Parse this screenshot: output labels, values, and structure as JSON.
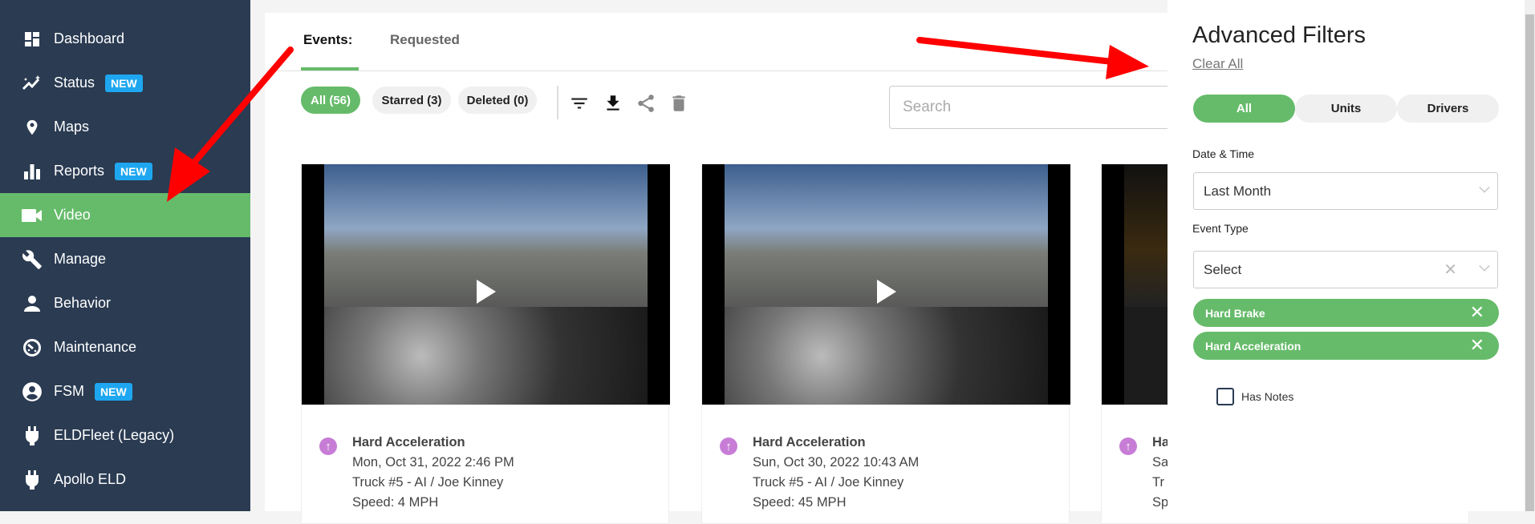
{
  "sidebar": {
    "items": [
      {
        "label": "Dashboard",
        "icon": "dashboard-icon"
      },
      {
        "label": "Status",
        "icon": "status-icon",
        "badge": "NEW"
      },
      {
        "label": "Maps",
        "icon": "map-pin-icon"
      },
      {
        "label": "Reports",
        "icon": "bar-chart-icon",
        "badge": "NEW"
      },
      {
        "label": "Video",
        "icon": "video-camera-icon",
        "active": true
      },
      {
        "label": "Manage",
        "icon": "wrench-icon"
      },
      {
        "label": "Behavior",
        "icon": "person-icon"
      },
      {
        "label": "Maintenance",
        "icon": "gauge-icon"
      },
      {
        "label": "FSM",
        "icon": "account-circle-icon",
        "badge": "NEW"
      },
      {
        "label": "ELDFleet (Legacy)",
        "icon": "plug-icon"
      },
      {
        "label": "Apollo ELD",
        "icon": "plug-icon"
      }
    ]
  },
  "main": {
    "tabs": [
      {
        "label": "Events:",
        "active": true
      },
      {
        "label": "Requested"
      }
    ],
    "filters": [
      {
        "label": "All (56)",
        "active": true
      },
      {
        "label": "Starred (3)"
      },
      {
        "label": "Deleted (0)"
      }
    ],
    "search_placeholder": "Search",
    "cards": [
      {
        "title": "Hard Acceleration",
        "date": "Mon, Oct 31, 2022 2:46 PM",
        "vehicle": "Truck #5 - AI / Joe Kinney",
        "speed": "Speed: 4 MPH"
      },
      {
        "title": "Hard Acceleration",
        "date": "Sun, Oct 30, 2022 10:43 AM",
        "vehicle": "Truck #5 - AI / Joe Kinney",
        "speed": "Speed: 45 MPH"
      },
      {
        "title": "Ha",
        "date": "Sa",
        "vehicle": "Tr",
        "speed": "Sp"
      }
    ]
  },
  "panel": {
    "title": "Advanced Filters",
    "clear_all": "Clear All",
    "segments": [
      {
        "label": "All",
        "active": true
      },
      {
        "label": "Units"
      },
      {
        "label": "Drivers"
      }
    ],
    "date_label": "Date & Time",
    "date_value": "Last Month",
    "event_type_label": "Event Type",
    "event_type_placeholder": "Select",
    "tags": [
      "Hard Brake",
      "Hard Acceleration"
    ],
    "has_notes_label": "Has Notes",
    "has_notes_checked": false
  },
  "colors": {
    "sidebar": "#2a3b52",
    "accent": "#66bb6a",
    "badge": "#1ea7f0",
    "event_icon": "#c77dd6",
    "annotation_arrow": "#ff0000"
  }
}
